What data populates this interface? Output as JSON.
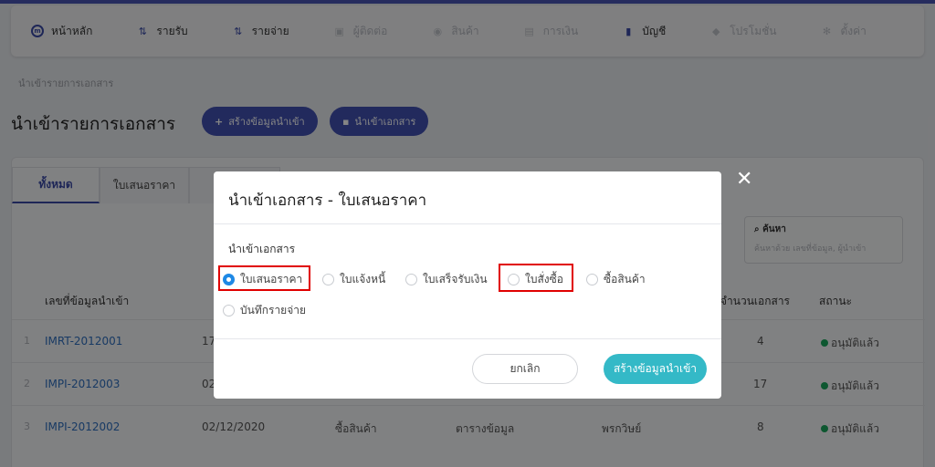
{
  "navbar": {
    "items": [
      {
        "label": "หน้าหลัก",
        "icon": "home-circle-icon",
        "enabled": true
      },
      {
        "label": "รายรับ",
        "icon": "income-icon",
        "enabled": true
      },
      {
        "label": "รายจ่าย",
        "icon": "expense-icon",
        "enabled": true
      },
      {
        "label": "ผู้ติดต่อ",
        "icon": "contacts-icon",
        "enabled": false
      },
      {
        "label": "สินค้า",
        "icon": "product-icon",
        "enabled": false
      },
      {
        "label": "การเงิน",
        "icon": "finance-icon",
        "enabled": false
      },
      {
        "label": "บัญชี",
        "icon": "accounting-icon",
        "enabled": true
      },
      {
        "label": "โปรโมชั่น",
        "icon": "promotion-icon",
        "enabled": false
      },
      {
        "label": "ตั้งค่า",
        "icon": "gear-icon",
        "enabled": false
      }
    ]
  },
  "breadcrumb": "นำเข้ารายการเอกสาร",
  "page": {
    "title": "นำเข้ารายการเอกสาร",
    "create_button": "สร้างข้อมูลนำเข้า",
    "import_button": "นำเข้าเอกสาร"
  },
  "tabs": [
    "ทั้งหมด",
    "ใบเสนอราคา"
  ],
  "search": {
    "label": "ค้นหา",
    "placeholder": "ค้นหาด้วย เลขที่ข้อมูล, ผู้นำเข้า"
  },
  "table": {
    "headers": {
      "code": "เลขที่ข้อมูลนำเข้า",
      "count": "จำนวนเอกสาร",
      "status": "สถานะ"
    },
    "rows": [
      {
        "idx": "1",
        "code": "IMRT-2012001",
        "date": "17",
        "type": "",
        "source": "",
        "by": "",
        "count": "4",
        "status": "อนุมัติแล้ว"
      },
      {
        "idx": "2",
        "code": "IMPI-2012003",
        "date": "02",
        "type": "",
        "source": "",
        "by": "",
        "count": "17",
        "status": "อนุมัติแล้ว"
      },
      {
        "idx": "3",
        "code": "IMPI-2012002",
        "date": "02/12/2020",
        "type": "ซื้อสินค้า",
        "source": "ตารางข้อมูล",
        "by": "พรกวิษย์",
        "count": "8",
        "status": "อนุมัติแล้ว"
      }
    ]
  },
  "modal": {
    "title": "นำเข้าเอกสาร - ใบเสนอราคา",
    "section_label": "นำเข้าเอกสาร",
    "options": [
      {
        "label": "ใบเสนอราคา",
        "checked": true
      },
      {
        "label": "ใบแจ้งหนี้",
        "checked": false
      },
      {
        "label": "ใบเสร็จรับเงิน",
        "checked": false
      },
      {
        "label": "ใบสั่งซื้อ",
        "checked": false
      },
      {
        "label": "ซื้อสินค้า",
        "checked": false
      },
      {
        "label": "บันทึกรายจ่าย",
        "checked": false
      }
    ],
    "cancel_label": "ยกเลิก",
    "create_label": "สร้างข้อมูลนำเข้า",
    "close_symbol": "✕"
  },
  "colors": {
    "primary": "#4151b3",
    "accent": "#34b9c7",
    "radio": "#1e88e5",
    "success": "#1aa75c",
    "highlight": "#e00000"
  }
}
